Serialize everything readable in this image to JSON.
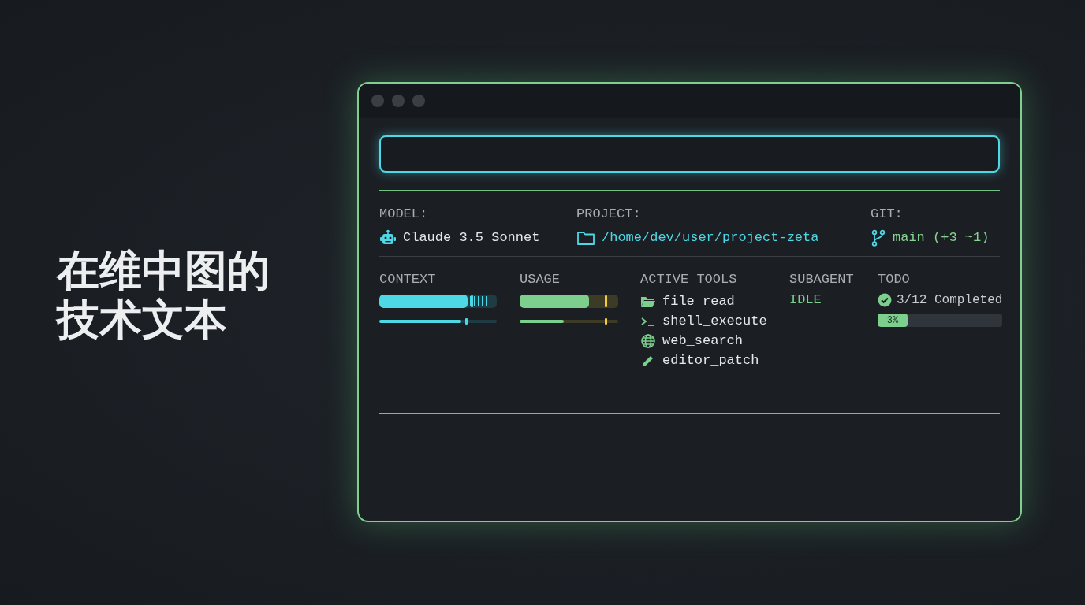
{
  "heading": "在维中图的技术文本",
  "info": [
    {
      "kind": "model",
      "label": "MODEL:",
      "value": "Claude 3.5 Sonnet"
    },
    {
      "kind": "project",
      "label": "PROJECT:",
      "value": "/home/dev/user/project-zeta"
    },
    {
      "kind": "git",
      "label": "GIT:",
      "value": "main (+3 ~1)"
    }
  ],
  "meters": [
    {
      "label": "CONTEXT",
      "kind": "context",
      "bars": [
        {
          "kind": "thick",
          "level": 0.75,
          "marker": {
            "level": 0.78
          }
        },
        {
          "kind": "thin",
          "level": 0.7,
          "marker": {
            "level": 0.73
          }
        }
      ]
    },
    {
      "label": "USAGE",
      "kind": "usage",
      "bars": [
        {
          "kind": "thick",
          "level": 0.7,
          "marker": {
            "level": 0.86
          }
        },
        {
          "kind": "thin",
          "level": 0.45,
          "marker": {
            "level": 0.86
          }
        }
      ]
    }
  ],
  "tools": {
    "label": "ACTIVE TOOLS",
    "items": [
      {
        "kind": "folder",
        "name": "file_read"
      },
      {
        "kind": "terminal",
        "name": "shell_execute"
      },
      {
        "kind": "globe",
        "name": "web_search"
      },
      {
        "kind": "pencil",
        "name": "editor_patch"
      }
    ]
  },
  "subagent": {
    "label": "SUBAGENT",
    "status": "IDLE"
  },
  "todo": {
    "label": "TODO",
    "summary": "3/12 Completed",
    "progress": {
      "level": 0.24,
      "text": "3%"
    }
  }
}
